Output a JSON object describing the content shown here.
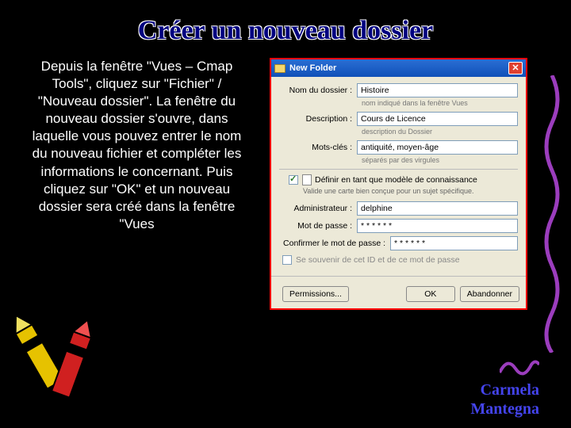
{
  "title": "Créer un nouveau dossier",
  "instructions": "Depuis la fenêtre \"Vues – Cmap Tools\", cliquez sur \"Fichier\" / \"Nouveau dossier\". La fenêtre du nouveau dossier s'ouvre, dans laquelle vous pouvez entrer le nom du nouveau fichier et compléter les informations le concernant. Puis cliquez sur \"OK\" et un nouveau dossier sera créé dans la fenêtre \"Vues",
  "dialog": {
    "title": "New Folder",
    "close": "✕",
    "fields": {
      "name_label": "Nom du dossier :",
      "name_value": "Histoire",
      "name_hint": "nom indiqué dans la fenêtre Vues",
      "desc_label": "Description :",
      "desc_value": "Cours de Licence",
      "desc_hint": "description du Dossier",
      "keywords_label": "Mots-clés :",
      "keywords_value": "antiquité, moyen-âge",
      "keywords_hint": "séparés par des virgules",
      "model_label": "Définir en tant que modèle de connaissance",
      "model_sub": "Valide une carte bien conçue pour un sujet spécifique.",
      "admin_label": "Administrateur :",
      "admin_value": "delphine",
      "pass_label": "Mot de passe :",
      "pass_value": "* * * * * *",
      "confirm_label": "Confirmer le mot de passe :",
      "confirm_value": "* * * * * *",
      "remember_label": "Se souvenir de cet ID et de ce mot de passe"
    },
    "buttons": {
      "permissions": "Permissions...",
      "ok": "OK",
      "cancel": "Abandonner"
    }
  },
  "footer": "Carmela\nMantegna"
}
